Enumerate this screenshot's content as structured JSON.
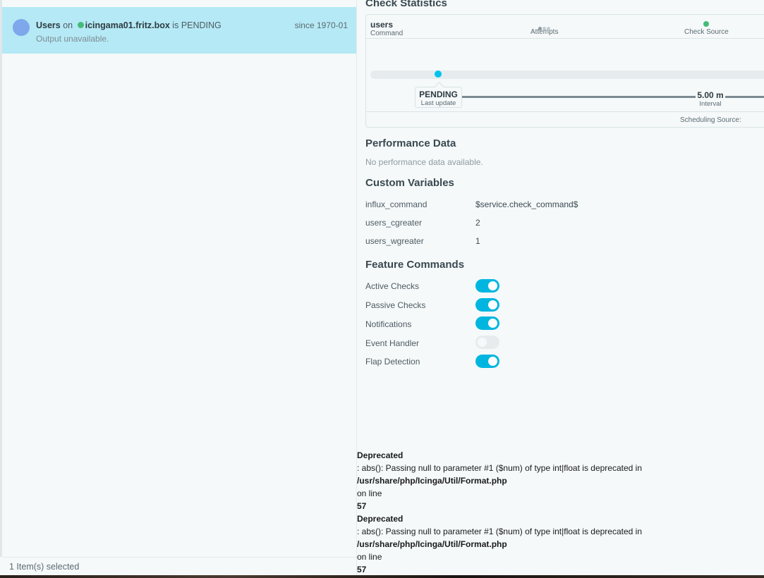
{
  "list": {
    "row": {
      "service": "Users",
      "on_text": "on",
      "host": "icingama01.fritz.box",
      "is_text": "is",
      "state": "PENDING",
      "since": "since 1970-01",
      "output": "Output unavailable."
    },
    "footer": "1 Item(s) selected"
  },
  "detail": {
    "check_statistics": {
      "title": "Check Statistics",
      "command_value": "users",
      "command_label": "Command",
      "attempts_label": "Attempts",
      "check_source_label": "Check Source",
      "last_update_value": "PENDING",
      "last_update_label": "Last update",
      "interval_value": "5.00 m",
      "interval_label": "Interval",
      "scheduling_source_label": "Scheduling Source:"
    },
    "performance": {
      "title": "Performance Data",
      "empty": "No performance data available."
    },
    "custom_vars": {
      "title": "Custom Variables",
      "items": [
        {
          "key": "influx_command",
          "value": "$service.check_command$"
        },
        {
          "key": "users_cgreater",
          "value": "2"
        },
        {
          "key": "users_wgreater",
          "value": "1"
        }
      ]
    },
    "features": {
      "title": "Feature Commands",
      "items": [
        {
          "label": "Active Checks",
          "enabled": true
        },
        {
          "label": "Passive Checks",
          "enabled": true
        },
        {
          "label": "Notifications",
          "enabled": true
        },
        {
          "label": "Event Handler",
          "enabled": false
        },
        {
          "label": "Flap Detection",
          "enabled": true
        }
      ]
    },
    "errors": [
      {
        "level": "Deprecated",
        "message": ": abs(): Passing null to parameter #1 ($num) of type int|float is deprecated in",
        "file": "/usr/share/php/Icinga/Util/Format.php",
        "on_line": "on line",
        "line": "57"
      },
      {
        "level": "Deprecated",
        "message": ": abs(): Passing null to parameter #1 ($num) of type int|float is deprecated in",
        "file": "/usr/share/php/Icinga/Util/Format.php",
        "on_line": "on line",
        "line": "57"
      }
    ]
  },
  "colors": {
    "selected_row": "#b5e9f5",
    "state_pending": "#7ea7ec",
    "host_up": "#44bb77",
    "toggle_on": "#00b6e0"
  },
  "icons": {
    "state": "state-ball-icon",
    "host_state": "host-up-dot-icon",
    "check_source": "check-source-dot-icon"
  }
}
